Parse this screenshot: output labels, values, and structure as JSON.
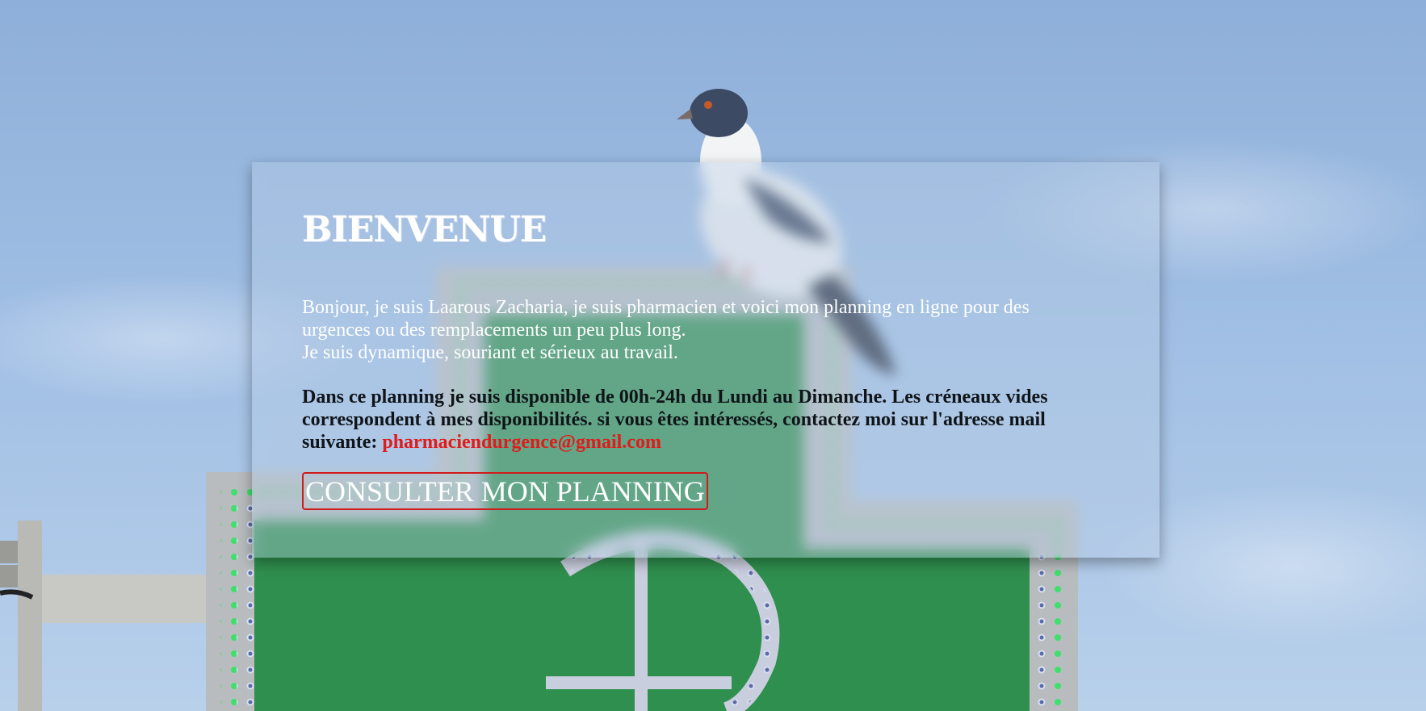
{
  "colors": {
    "sky": "#9fbde3",
    "sign_green": "#2f8f4e",
    "cta_border": "#d11a1a",
    "email": "#e01b1b"
  },
  "background": {
    "subject": "pigeon-on-pharmacy-cross-sign"
  },
  "welcome": {
    "title": "BIENVENUE",
    "intro_line_1": "Bonjour, je suis Laarous Zacharia, je suis pharmacien et voici mon planning en ligne pour des urgences ou des remplacements un peu plus long.",
    "intro_line_2": "Je suis dynamique, souriant et sérieux au travail.",
    "details": "Dans ce planning je suis disponible de 00h-24h du Lundi au Dimanche. Les créneaux vides correspondent à mes disponibilités. si vous êtes intéressés, contactez moi sur l'adresse mail suivante:",
    "email": "pharmaciendurgence@gmail.com",
    "cta_label": "CONSULTER MON PLANNING"
  }
}
